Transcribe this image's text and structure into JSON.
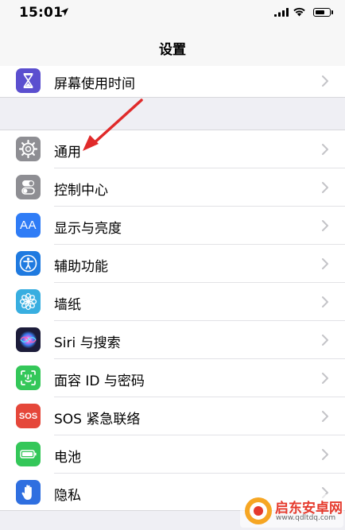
{
  "status_bar": {
    "time": "15:01",
    "icons": [
      "location-arrow-icon",
      "signal-icon",
      "wifi-icon",
      "battery-icon"
    ],
    "battery_level": 0.7
  },
  "nav": {
    "title": "设置"
  },
  "group1": [
    {
      "label": "屏幕使用时间",
      "icon": "hourglass-icon",
      "color": "#5b4fcf"
    }
  ],
  "group2": [
    {
      "label": "通用",
      "icon": "gear-icon",
      "color": "#8e8e93"
    },
    {
      "label": "控制中心",
      "icon": "toggle-icon",
      "color": "#8e8e93"
    },
    {
      "label": "显示与亮度",
      "icon": "text-size-icon",
      "color": "#2f7cf6"
    },
    {
      "label": "辅助功能",
      "icon": "accessibility-icon",
      "color": "#1f7ae0"
    },
    {
      "label": "墙纸",
      "icon": "flower-icon",
      "color": "#38aee0"
    },
    {
      "label": "Siri 与搜索",
      "icon": "siri-icon",
      "color": "#1c1c3a"
    },
    {
      "label": "面容 ID 与密码",
      "icon": "face-id-icon",
      "color": "#34c759"
    },
    {
      "label": "SOS 紧急联络",
      "icon": "sos-icon",
      "color": "#e5473a"
    },
    {
      "label": "电池",
      "icon": "battery-icon",
      "color": "#34c759"
    },
    {
      "label": "隐私",
      "icon": "hand-icon",
      "color": "#2f6fe0"
    }
  ],
  "icon_text": {
    "text_size": "AA",
    "sos": "SOS"
  },
  "annotation": {
    "arrow_color": "#e02a2a"
  },
  "watermark": {
    "text": "启东安卓网",
    "url": "www.qdltdq.com"
  }
}
